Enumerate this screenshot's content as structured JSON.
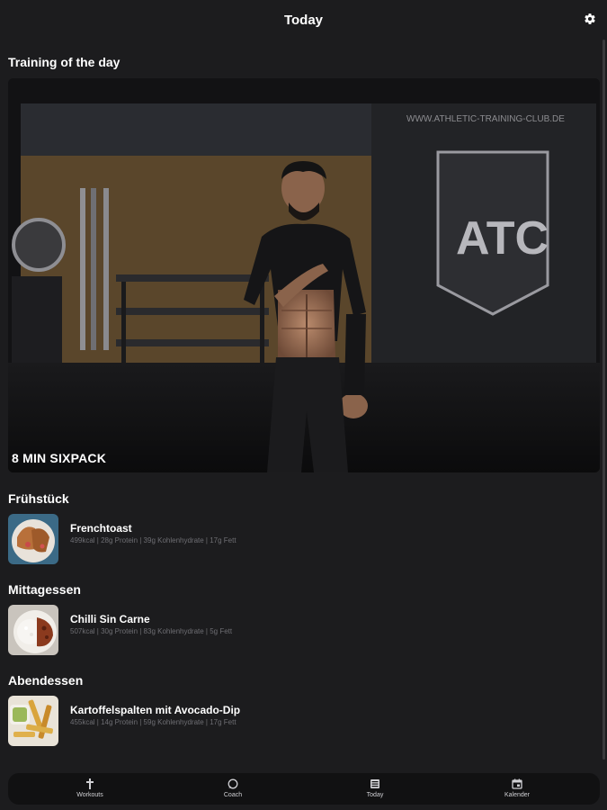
{
  "header": {
    "title": "Today",
    "settings_icon": "gear-icon"
  },
  "training": {
    "section_title": "Training of the day",
    "workout_title": "8 MIN SIXPACK",
    "wall_sign": "WWW.ATHLETIC-TRAINING-CLUB.DE",
    "logo_text": "ATC"
  },
  "meals": [
    {
      "section_title": "Frühstück",
      "name": "Frenchtoast",
      "macros": "499kcal | 28g Protein | 39g Kohlenhydrate | 17g Fett"
    },
    {
      "section_title": "Mittagessen",
      "name": "Chilli Sin Carne",
      "macros": "507kcal | 30g Protein | 83g Kohlenhydrate | 5g Fett"
    },
    {
      "section_title": "Abendessen",
      "name": "Kartoffelspalten mit Avocado-Dip",
      "macros": "455kcal | 14g Protein | 59g Kohlenhydrate | 17g Fett"
    }
  ],
  "tabbar": {
    "tabs": [
      {
        "label": "Workouts",
        "icon": "cross-icon"
      },
      {
        "label": "Coach",
        "icon": "chat-icon"
      },
      {
        "label": "Today",
        "icon": "list-icon"
      },
      {
        "label": "Kalender",
        "icon": "calendar-icon"
      }
    ]
  },
  "colors": {
    "background": "#1c1c1e",
    "tabbar": "#111112",
    "muted_text": "#6e6e73"
  }
}
